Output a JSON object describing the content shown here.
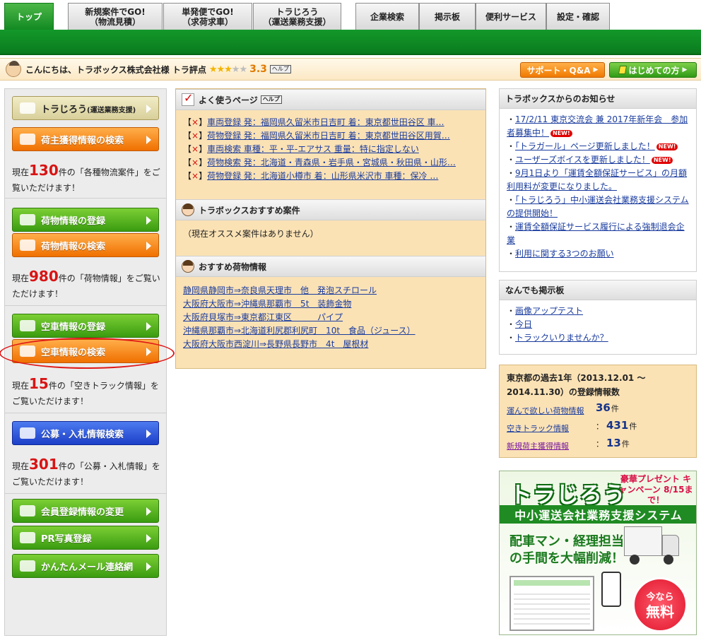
{
  "nav": {
    "tabs": [
      {
        "label": "トップ",
        "active": true
      },
      {
        "line1": "新規案件でGO!",
        "line2": "（物流見積）"
      },
      {
        "line1": "単発便でGO!",
        "line2": "（求荷求車）"
      },
      {
        "line1": "トラじろう",
        "line2": "（運送業務支援）"
      },
      {
        "label": "企業検索"
      },
      {
        "label": "掲示板"
      },
      {
        "label": "便利サービス"
      },
      {
        "label": "設定・確認"
      }
    ]
  },
  "greeting": {
    "text": "こんにちは、トラボックス株式会社様 トラ評点",
    "stars_filled": "★★★",
    "stars_empty": "★★",
    "rating_value": 3.3,
    "score": "3.3",
    "help": "ヘルプ",
    "support_button": "サポート・Q&A",
    "first_button": "はじめての方"
  },
  "sidebar": {
    "torajiro": {
      "label": "トラじろう",
      "sub": "(運送業務支援)"
    },
    "shipper_search": "荷主獲得情報の検索",
    "shipper_desc": {
      "pre": "現在",
      "num": "130",
      "mid": "件の「各種物流案件」をご覧いただけます！"
    },
    "cargo_register": "荷物情報の登録",
    "cargo_search": "荷物情報の検索",
    "cargo_desc": {
      "pre": "現在",
      "num": "980",
      "mid": "件の「荷物情報」をご覧いただけます！"
    },
    "truck_register": "空車情報の登録",
    "truck_search": "空車情報の検索",
    "truck_desc": {
      "pre": "現在",
      "num": "15",
      "mid": "件の「空きトラック情報」をご覧いただけます！"
    },
    "tender_search": "公募・入札情報検索",
    "tender_desc": {
      "pre": "現在",
      "num": "301",
      "mid": "件の「公募・入札情報」をご覧いただけます！"
    },
    "member_edit": "会員登録情報の変更",
    "pr_photo": "PR写真登録",
    "mail": "かんたんメール連絡網"
  },
  "middle": {
    "frequent": {
      "title": "よく使うページ",
      "help": "ヘルプ",
      "items": [
        "車両登録 発：福岡県久留米市日吉町 着：東京都世田谷区 車…",
        "荷物登録 発：福岡県久留米市日吉町 着：東京都世田谷区用賀…",
        "車両検索 車種：平・平-エアサス 重量：特に指定しない",
        "荷物検索 発：北海道・青森県・岩手県・宮城県・秋田県・山形…",
        "荷物登録 発：北海道小樽市 着：山形県米沢市 車種：保冷 …"
      ]
    },
    "recommend": {
      "title": "トラボックスおすすめ案件",
      "empty": "（現在オススメ案件はありません）"
    },
    "cargo_recommend": {
      "title": "おすすめ荷物情報",
      "items": [
        "静岡県静岡市⇒奈良県天理市　他　発泡スチロール",
        "大阪府大阪市⇒沖縄県那覇市　5t　装飾金物",
        "大阪府貝塚市⇒東京都江東区　　　パイプ",
        "沖縄県那覇市⇒北海道利尻郡利尻町　10t　食品（ジュース）",
        "大阪府大阪市西淀川⇒長野県長野市　4t　屋根材"
      ]
    }
  },
  "right": {
    "news": {
      "title": "トラボックスからのお知らせ",
      "items": [
        {
          "text": "17/2/11 東京交流会 兼 2017年新年会　参加者募集中！",
          "new": true
        },
        {
          "text": "「トラガール」ページ更新しました！",
          "new": true
        },
        {
          "text": "ユーザーズボイスを更新しました！",
          "new": true
        },
        {
          "text": "9月1日より「運賃全額保証サービス」の月額利用料が変更になりました。",
          "new": false
        },
        {
          "text": "「トラじろう」中小運送会社業務支援システムの提供開始！",
          "new": false
        },
        {
          "text": "運賃全額保証サービス履行による強制退会企業",
          "new": false
        },
        {
          "text": "利用に関する3つのお願い",
          "new": false
        }
      ],
      "new_label": "NEW!"
    },
    "board": {
      "title": "なんでも掲示板",
      "items": [
        "画像アップテスト",
        "今日",
        "トラックいりませんか？"
      ]
    },
    "stats": {
      "heading": "東京都の過去1年（2013.12.01 ～ 2014.11.30）の登録情報数",
      "rows": [
        {
          "label": "運んで欲しい荷物情報",
          "value": "36",
          "unit": "件"
        },
        {
          "label": "空きトラック情報",
          "value": "431",
          "unit": "件"
        },
        {
          "label": "新規荷主獲得情報",
          "value": "13",
          "unit": "件"
        }
      ]
    },
    "banner": {
      "title": "トラじろう",
      "promo": "豪華プレゼント キャンペーン 8/15まで！",
      "bar": "中小運送会社業務支援システム",
      "copy1": "配車マン・経理担当",
      "copy2": "の手間を大幅削減！",
      "badge1": "今なら",
      "badge2": "無料"
    }
  }
}
